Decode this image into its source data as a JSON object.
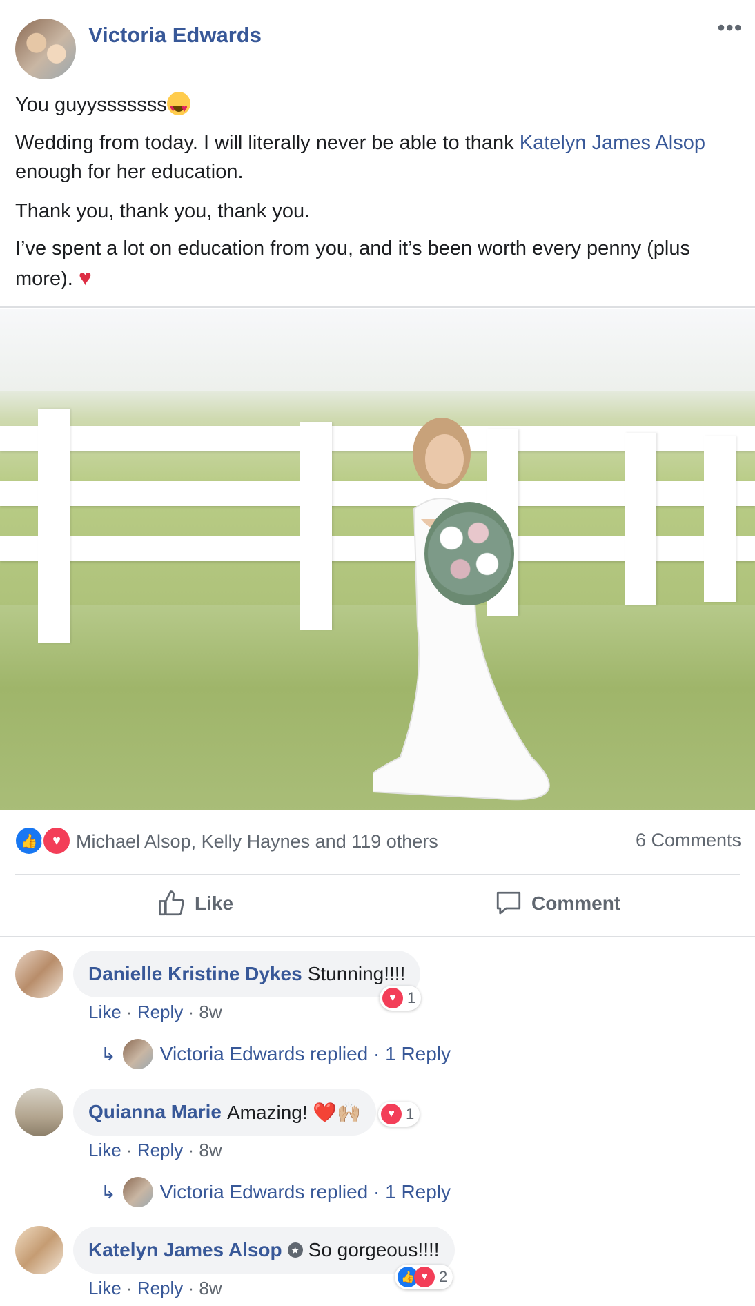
{
  "post": {
    "author": "Victoria Edwards",
    "more_label": "•••",
    "line1": "You guyysssssss",
    "line2_pre": "Wedding from today. I will literally never be able to thank ",
    "line2_link": "Katelyn James Alsop",
    "line2_post": " enough for her education.",
    "line3": "Thank you, thank you, thank you.",
    "line4": "I’ve spent a lot on education from you, and it’s been worth every penny (plus more). "
  },
  "reactions": {
    "summary": "Michael Alsop, Kelly Haynes and 119 others",
    "comments_count": "6 Comments"
  },
  "actions": {
    "like": "Like",
    "comment": "Comment"
  },
  "comments": [
    {
      "name": "Danielle Kristine Dykes",
      "text": "Stunning!!!!",
      "reaction_count": "1",
      "like": "Like",
      "reply": "Reply",
      "time": "8w",
      "replied_text": "Victoria Edwards replied · 1 Reply"
    },
    {
      "name": "Quianna Marie",
      "text": "Amazing! ❤️🙌🏼",
      "reaction_count": "1",
      "like": "Like",
      "reply": "Reply",
      "time": "8w",
      "replied_text": "Victoria Edwards replied · 1 Reply"
    },
    {
      "name": "Katelyn James Alsop",
      "text": "So gorgeous!!!!",
      "reaction_count": "2",
      "like": "Like",
      "reply": "Reply",
      "time": "8w"
    }
  ],
  "colors": {
    "link": "#385898",
    "muted": "#606770",
    "like_blue": "#1877f2",
    "love_red": "#f33e58",
    "bubble_bg": "#f2f3f5"
  }
}
